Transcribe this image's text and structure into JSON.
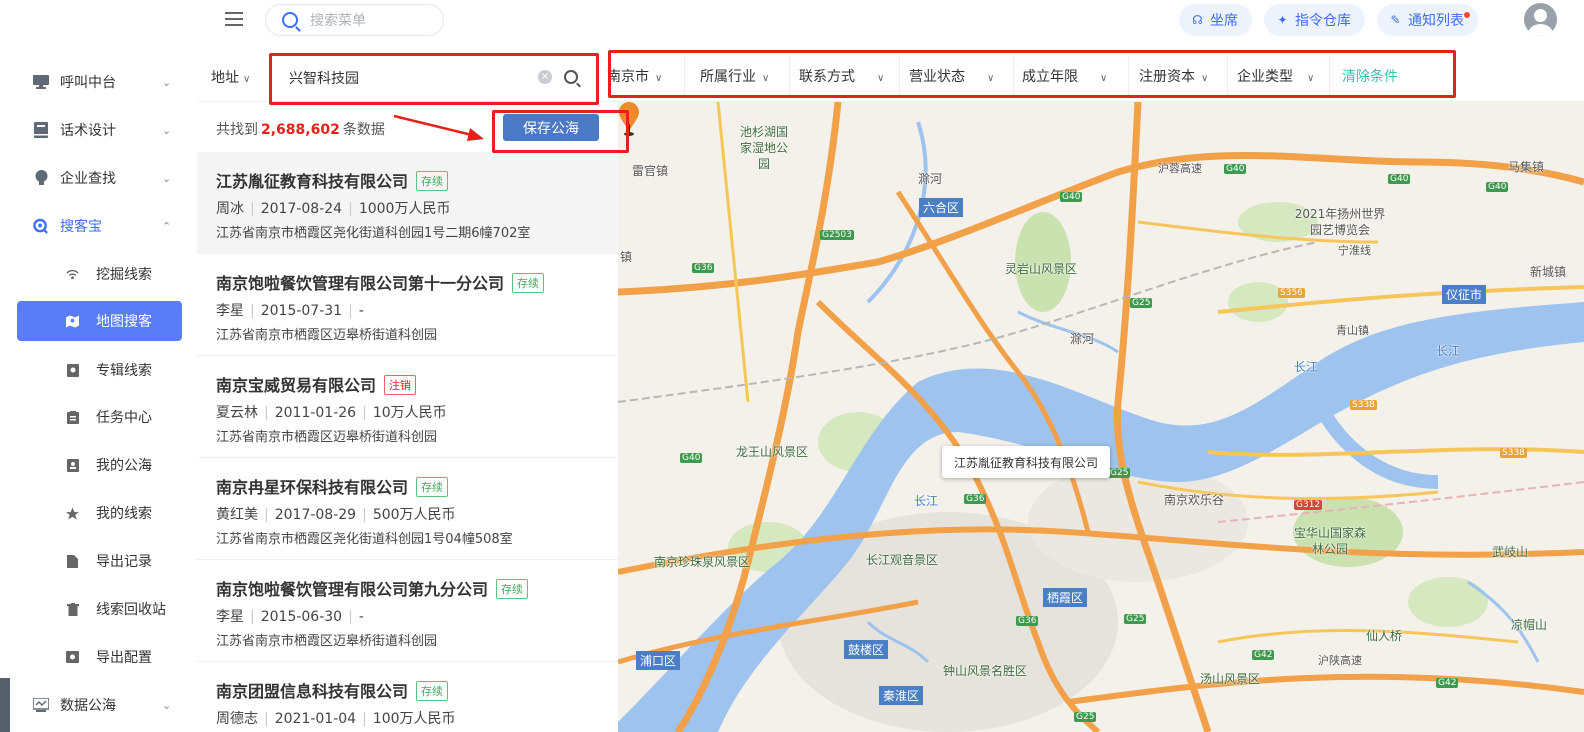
{
  "topbar": {
    "search_placeholder": "搜索菜单",
    "pills": [
      {
        "label": "坐席",
        "icon": "headset-icon"
      },
      {
        "label": "指令仓库",
        "icon": "pin-icon"
      },
      {
        "label": "通知列表",
        "icon": "bell-icon"
      }
    ]
  },
  "sidebar": {
    "items": [
      {
        "label": "呼叫中台",
        "icon": "monitor-icon",
        "chevron": "⌄"
      },
      {
        "label": "话术设计",
        "icon": "book-icon",
        "chevron": "⌄"
      },
      {
        "label": "企业查找",
        "icon": "bulb-icon",
        "chevron": "⌄"
      },
      {
        "label": "搜客宝",
        "icon": "search-icon",
        "chevron": "⌃"
      },
      {
        "label": "挖掘线索",
        "icon": "signal-icon"
      },
      {
        "label": "地图搜客",
        "icon": "map-icon"
      },
      {
        "label": "专辑线索",
        "icon": "album-icon"
      },
      {
        "label": "任务中心",
        "icon": "clipboard-icon"
      },
      {
        "label": "我的公海",
        "icon": "contact-icon"
      },
      {
        "label": "我的线索",
        "icon": "star-icon"
      },
      {
        "label": "导出记录",
        "icon": "file-icon"
      },
      {
        "label": "线索回收站",
        "icon": "trash-icon"
      },
      {
        "label": "导出配置",
        "icon": "settings-icon"
      },
      {
        "label": "数据公海",
        "icon": "database-icon",
        "chevron": "⌄"
      }
    ]
  },
  "filter": {
    "address_label": "地址",
    "keyword_value": "兴智科技园",
    "options": [
      "南京市",
      "所属行业",
      "联系方式",
      "营业状态",
      "成立年限",
      "注册资本",
      "企业类型"
    ],
    "clear_label": "清除条件"
  },
  "results": {
    "count_prefix": "共找到",
    "count_value": "2,688,602",
    "count_suffix": "条数据",
    "save_button": "保存公海",
    "items": [
      {
        "name": "江苏胤征教育科技有限公司",
        "status": "存续",
        "person": "周冰",
        "date": "2017-08-24",
        "capital": "1000万人民币",
        "address": "江苏省南京市栖霞区尧化街道科创园1号二期6幢702室"
      },
      {
        "name": "南京饱啦餐饮管理有限公司第十一分公司",
        "status": "存续",
        "person": "李星",
        "date": "2015-07-31",
        "capital": "-",
        "address": "江苏省南京市栖霞区迈皋桥街道科创园"
      },
      {
        "name": "南京宝威贸易有限公司",
        "status": "注销",
        "person": "夏云林",
        "date": "2011-01-26",
        "capital": "10万人民币",
        "address": "江苏省南京市栖霞区迈皋桥街道科创园"
      },
      {
        "name": "南京冉星环保科技有限公司",
        "status": "存续",
        "person": "黄红美",
        "date": "2017-08-29",
        "capital": "500万人民币",
        "address": "江苏省南京市栖霞区尧化街道科创园1号04幢508室"
      },
      {
        "name": "南京饱啦餐饮管理有限公司第九分公司",
        "status": "存续",
        "person": "李星",
        "date": "2015-06-30",
        "capital": "-",
        "address": "江苏省南京市栖霞区迈皋桥街道科创园"
      },
      {
        "name": "南京团盟信息科技有限公司",
        "status": "存续",
        "person": "周德志",
        "date": "2021-01-04",
        "capital": "100万人民币",
        "address": ""
      }
    ]
  },
  "map": {
    "popup": "江苏胤征教育科技有限公司",
    "labels": {
      "chishan": "池杉湖国家湿地公园",
      "leiguan": "雷官镇",
      "luhe": "六合区",
      "lingyan": "灵岩山风景区",
      "yangzhou": "2021年扬州世界园艺博览会",
      "majizhen": "马集镇",
      "ninghe": "宁淮线",
      "xincheng": "新城镇",
      "yizheng": "仪征市",
      "qingshan": "青山镇",
      "chuhe": "滁河",
      "chuhe2": "滁河",
      "changjiang": "长江",
      "changjiang2": "长江",
      "changjiang3": "长江",
      "longwang": "龙王山风景区",
      "huanle": "南京欢乐谷",
      "baohua": "宝华山国家森林公园",
      "wuqi": "武岐山",
      "zhenzhu": "南京珍珠泉风景区",
      "guanyin": "长江观音景区",
      "qixia": "栖霞区",
      "xianren": "仙人桥",
      "lianghao": "凉帽山",
      "pukou": "浦口区",
      "gulou": "鼓楼区",
      "zhongshan": "钟山风景名胜区",
      "tangshan": "汤山风景区",
      "qinhuai": "秦淮区",
      "hushan": "沪陕高速",
      "ninghu": "沪蓉高速",
      "jing": "镇"
    },
    "roads": [
      "G40",
      "G40",
      "G40",
      "G2503",
      "G36",
      "G25",
      "S356",
      "S338",
      "S338",
      "G40",
      "G36",
      "G312",
      "G25",
      "G36",
      "G25",
      "G42",
      "G42",
      "G25",
      "G40"
    ]
  }
}
